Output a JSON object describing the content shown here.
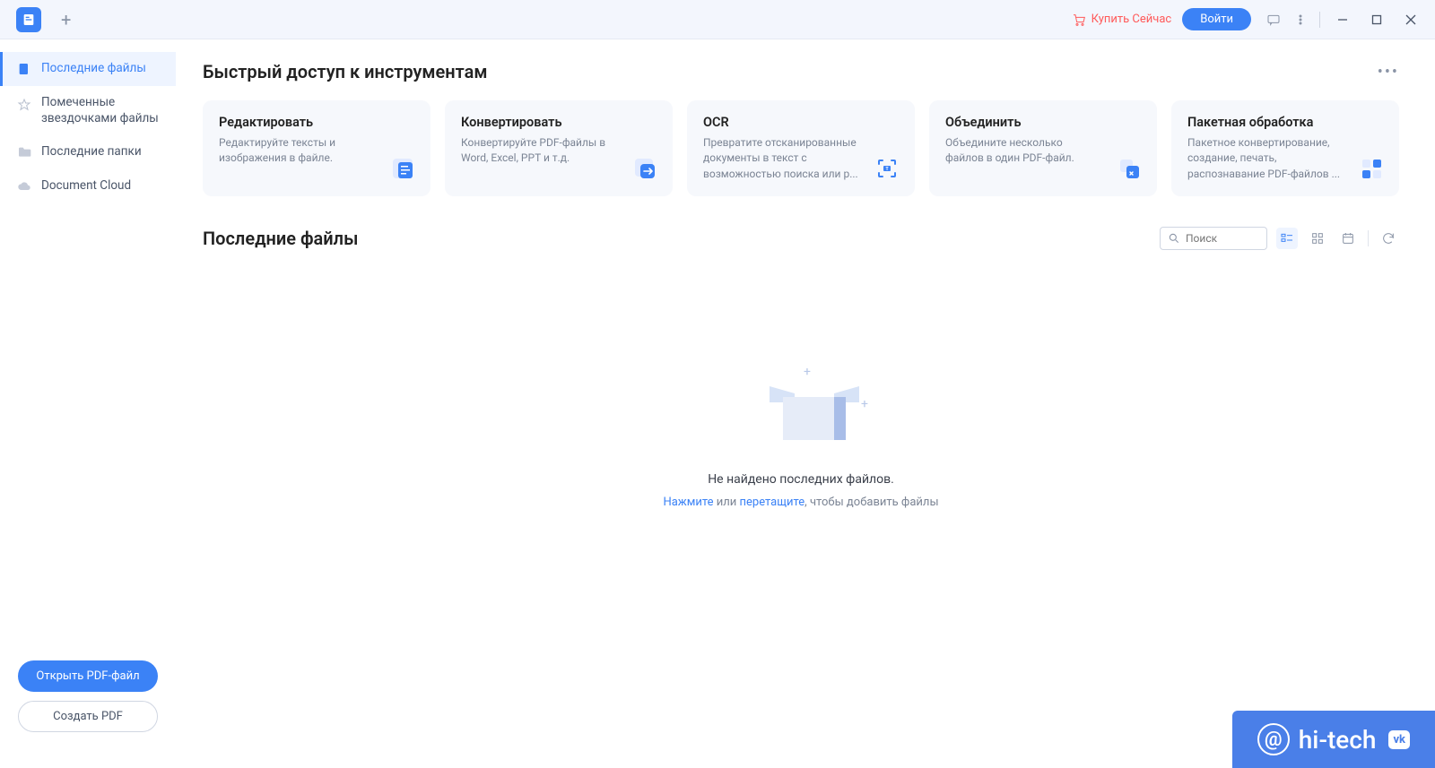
{
  "titlebar": {
    "buy_now": "Купить Сейчас",
    "login": "Войти"
  },
  "sidebar": {
    "items": [
      {
        "label": "Последние файлы"
      },
      {
        "label": "Помеченные звездочками файлы"
      },
      {
        "label": "Последние папки"
      },
      {
        "label": "Document Cloud"
      }
    ],
    "open_pdf": "Открыть PDF-файл",
    "create_pdf": "Создать PDF"
  },
  "quick_access": {
    "title": "Быстрый доступ к инструментам",
    "cards": [
      {
        "title": "Редактировать",
        "desc": "Редактируйте тексты и изображения в файле."
      },
      {
        "title": "Конвертировать",
        "desc": "Конвертируйте PDF-файлы в Word, Excel, PPT и т.д."
      },
      {
        "title": "OCR",
        "desc": "Превратите отсканированные документы в текст с возможностью поиска или р..."
      },
      {
        "title": "Объединить",
        "desc": "Объедините несколько файлов в один PDF-файл."
      },
      {
        "title": "Пакетная обработка",
        "desc": "Пакетное конвертирование, создание, печать, распознавание PDF-файлов ..."
      }
    ]
  },
  "recent": {
    "title": "Последние файлы",
    "search_placeholder": "Поиск",
    "empty_msg": "Не найдено последних файлов.",
    "hint_click": "Нажмите",
    "hint_or": " или  ",
    "hint_drag": "перетащите",
    "hint_rest": ", чтобы добавить файлы"
  },
  "watermark": {
    "text": "hi-tech",
    "badge": "vk"
  }
}
